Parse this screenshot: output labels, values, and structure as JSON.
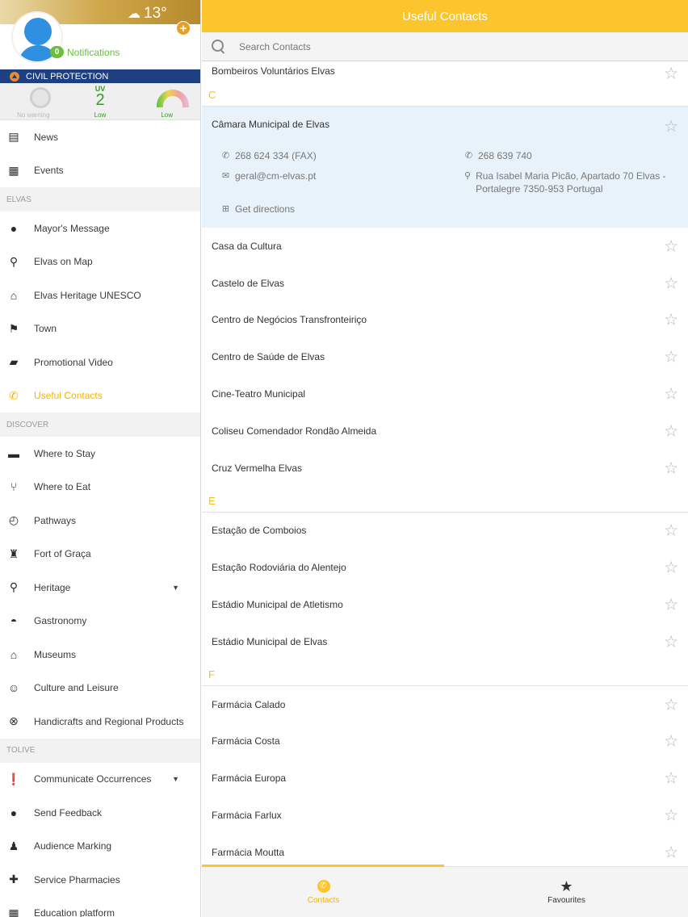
{
  "sidebar": {
    "weather": {
      "temp": "13°",
      "icon": "cloud-sun-icon"
    },
    "notifications": {
      "count": "0",
      "label": "Notifications"
    },
    "civil_protection": "CIVIL PROTECTION",
    "indicators": {
      "warning": {
        "label": "No warning"
      },
      "uv": {
        "title": "UV",
        "value": "2",
        "level": "Low"
      },
      "air": {
        "level": "Low"
      }
    },
    "items_top": [
      {
        "label": "News",
        "icon": "newspaper-icon"
      },
      {
        "label": "Events",
        "icon": "calendar-icon"
      }
    ],
    "section_elvas": "ELVAS",
    "items_elvas": [
      {
        "label": "Mayor's Message",
        "icon": "person-icon"
      },
      {
        "label": "Elvas on Map",
        "icon": "map-pin-icon"
      },
      {
        "label": "Elvas Heritage UNESCO",
        "icon": "museum-icon"
      },
      {
        "label": "Town",
        "icon": "flag-icon"
      },
      {
        "label": "Promotional Video",
        "icon": "clapperboard-icon"
      },
      {
        "label": "Useful Contacts",
        "icon": "phone-icon",
        "active": true
      }
    ],
    "section_discover": "DISCOVER",
    "items_discover": [
      {
        "label": "Where to Stay",
        "icon": "bed-icon"
      },
      {
        "label": "Where to Eat",
        "icon": "cutlery-icon"
      },
      {
        "label": "Pathways",
        "icon": "compass-icon"
      },
      {
        "label": "Fort of Graça",
        "icon": "tower-icon"
      },
      {
        "label": "Heritage",
        "icon": "map-pin-icon",
        "dropdown": true
      },
      {
        "label": "Gastronomy",
        "icon": "cloche-icon"
      },
      {
        "label": "Museums",
        "icon": "museum-icon"
      },
      {
        "label": "Culture and Leisure",
        "icon": "theater-masks-icon"
      },
      {
        "label": "Handicrafts and Regional Products",
        "icon": "basket-icon"
      }
    ],
    "section_tolive": "TOLIVE",
    "items_tolive": [
      {
        "label": "Communicate Occurrences",
        "icon": "alert-icon",
        "dropdown": true
      },
      {
        "label": "Send Feedback",
        "icon": "chat-bubble-icon"
      },
      {
        "label": "Audience Marking",
        "icon": "person-desk-icon"
      },
      {
        "label": "Service Pharmacies",
        "icon": "pharmacy-icon"
      },
      {
        "label": "Education platform",
        "icon": "calendar-icon"
      }
    ]
  },
  "main": {
    "title": "Useful Contacts",
    "search_placeholder": "Search Contacts",
    "top_row": "Bombeiros Voluntários Elvas",
    "letter_c": "C",
    "expanded": {
      "name": "Câmara Municipal de Elvas",
      "fax": "268 624 334 (FAX)",
      "phone": "268 639 740",
      "email": "geral@cm-elvas.pt",
      "address": "Rua Isabel Maria Picão, Apartado 70 Elvas - Portalegre 7350-953 Portugal",
      "directions": "Get directions"
    },
    "group_c": [
      "Casa da Cultura",
      "Castelo de Elvas",
      "Centro de Negócios Transfronteiriço",
      "Centro de Saúde de Elvas",
      "Cine-Teatro Municipal",
      "Coliseu Comendador Rondão Almeida",
      "Cruz Vermelha Elvas"
    ],
    "letter_e": "E",
    "group_e": [
      "Estação de Comboios",
      "Estação Rodoviária do Alentejo",
      "Estádio Municipal de Atletismo",
      "Estádio Municipal de Elvas"
    ],
    "letter_f": "F",
    "group_f": [
      "Farmácia Calado",
      "Farmácia Costa",
      "Farmácia Europa",
      "Farmácia Farlux",
      "Farmácia Moutta"
    ],
    "tabs": [
      {
        "label": "Contacts",
        "icon": "phone-icon",
        "active": true
      },
      {
        "label": "Favourites",
        "icon": "star-icon",
        "active": false
      }
    ]
  },
  "colors": {
    "accent": "#fcc52e",
    "civil_protection": "#1e3f80",
    "uv_green": "#3a9a2a"
  }
}
